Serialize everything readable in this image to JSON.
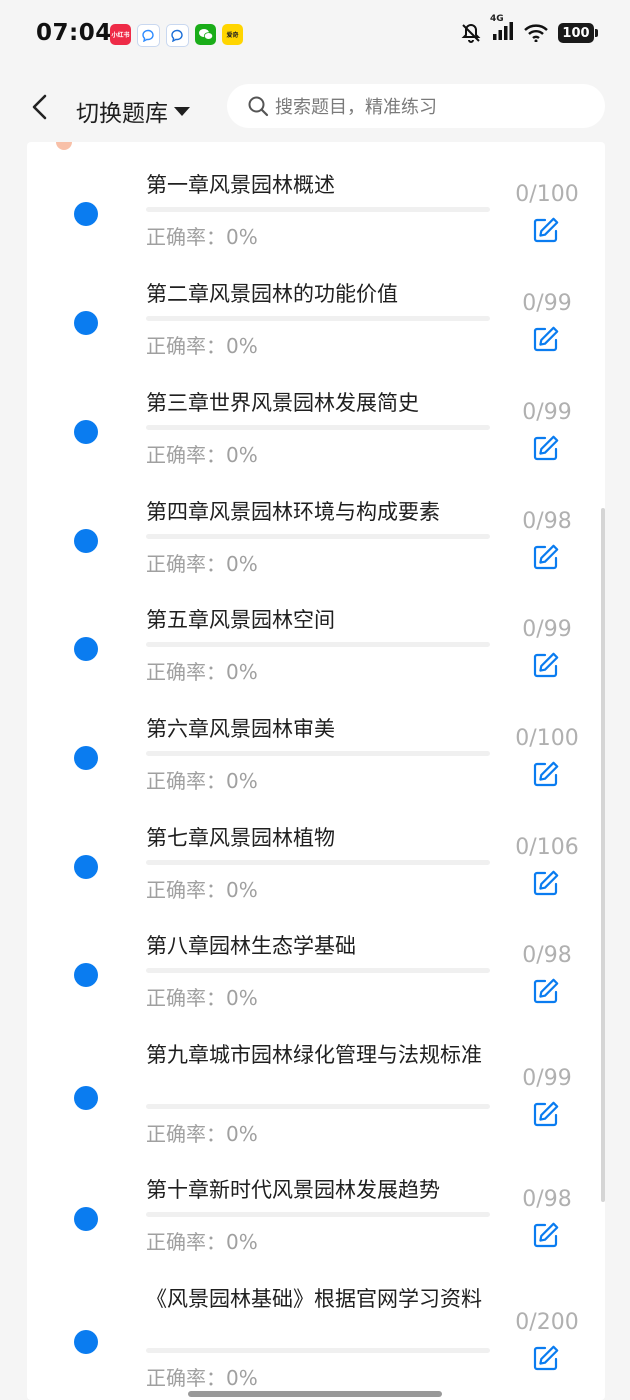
{
  "status_bar": {
    "time": "07:04",
    "app_icons": [
      "小红书",
      "",
      "",
      "",
      "爱奇"
    ],
    "network": "4G",
    "battery": "100"
  },
  "header": {
    "title": "切换题库",
    "search_placeholder": "搜索题目，精准练习"
  },
  "accent_color": "#0a7cf0",
  "chapters": [
    {
      "title": "第一章风景园林概述",
      "accuracy": "正确率：0%",
      "count": "0/100"
    },
    {
      "title": "第二章风景园林的功能价值",
      "accuracy": "正确率：0%",
      "count": "0/99"
    },
    {
      "title": "第三章世界风景园林发展简史",
      "accuracy": "正确率：0%",
      "count": "0/99"
    },
    {
      "title": "第四章风景园林环境与构成要素",
      "accuracy": "正确率：0%",
      "count": "0/98"
    },
    {
      "title": "第五章风景园林空间",
      "accuracy": "正确率：0%",
      "count": "0/99"
    },
    {
      "title": "第六章风景园林审美",
      "accuracy": "正确率：0%",
      "count": "0/100"
    },
    {
      "title": "第七章风景园林植物",
      "accuracy": "正确率：0%",
      "count": "0/106"
    },
    {
      "title": "第八章园林生态学基础",
      "accuracy": "正确率：0%",
      "count": "0/98"
    },
    {
      "title": "第九章城市园林绿化管理与法规标准",
      "accuracy": "正确率：0%",
      "count": "0/99"
    },
    {
      "title": "第十章新时代风景园林发展趋势",
      "accuracy": "正确率：0%",
      "count": "0/98"
    },
    {
      "title": "《风景园林基础》根据官网学习资料",
      "accuracy": "正确率：0%",
      "count": "0/200"
    }
  ]
}
